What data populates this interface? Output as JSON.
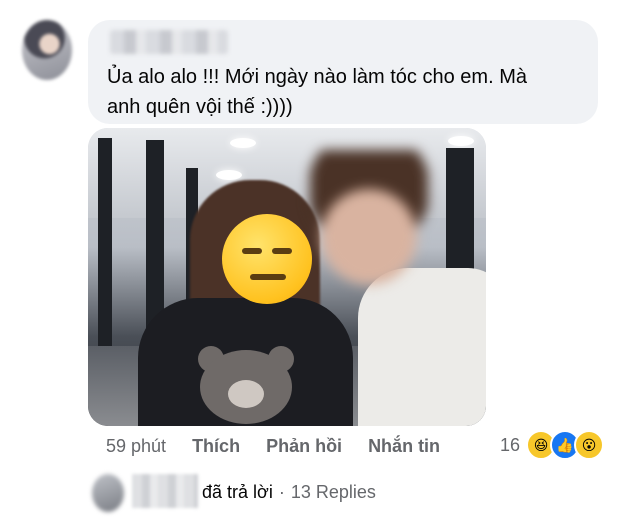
{
  "comment": {
    "text_line1": "Ủa alo alo !!! Mới ngày nào làm tóc cho em. Mà",
    "text_line2": "anh quên vội thế :))))"
  },
  "actions": {
    "time": "59 phút",
    "like_label": "Thích",
    "reply_label": "Phản hồi",
    "message_label": "Nhắn tin"
  },
  "reactions": {
    "count": "16",
    "icons": [
      "haha-icon",
      "like-icon",
      "wow-icon"
    ]
  },
  "replies": {
    "replied_text": "đã trả lời",
    "separator": "·",
    "count_label": "13 Replies"
  },
  "colors": {
    "bubble_bg": "#f0f2f5",
    "meta_text": "#65676b",
    "like_blue": "#1877f2",
    "reaction_yellow": "#f7c72a"
  }
}
